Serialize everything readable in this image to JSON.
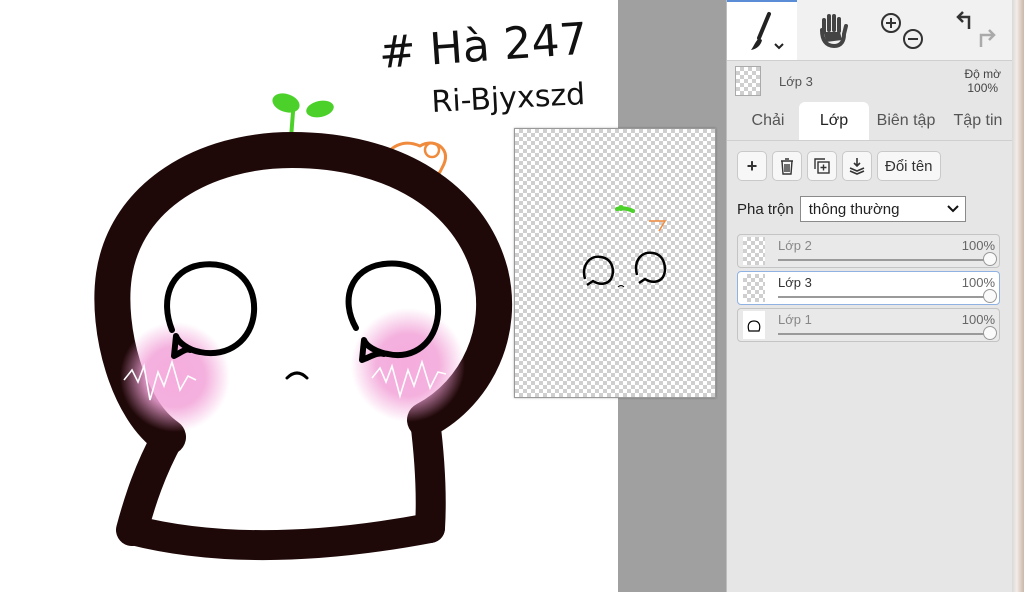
{
  "canvas": {
    "handwriting_line1": "# Hà 247",
    "handwriting_line2": "Ri-Bjyxszd"
  },
  "toolbar": {
    "tools": [
      {
        "name": "brush",
        "icon": "brush-icon",
        "active": true
      },
      {
        "name": "hand",
        "icon": "hand-icon",
        "active": false
      },
      {
        "name": "zoom",
        "icon": "zoom-in-out-icon",
        "active": false
      },
      {
        "name": "undo-redo",
        "icon": "undo-redo-icon",
        "active": false
      }
    ]
  },
  "current_layer": {
    "name": "Lớp 3",
    "opacity_label": "Độ mờ",
    "opacity_value": "100%"
  },
  "tabs": [
    {
      "label": "Chải",
      "active": false
    },
    {
      "label": "Lớp",
      "active": true
    },
    {
      "label": "Biên tập",
      "active": false
    },
    {
      "label": "Tập tin",
      "active": false
    }
  ],
  "layer_buttons": {
    "add": "+",
    "rename": "Đổi tên"
  },
  "blend": {
    "label": "Pha trộn",
    "selected": "thông thường"
  },
  "layers": [
    {
      "name": "Lớp 2",
      "opacity": "100%",
      "opacity_fraction": 1.0,
      "selected": false
    },
    {
      "name": "Lớp 3",
      "opacity": "100%",
      "opacity_fraction": 1.0,
      "selected": true
    },
    {
      "name": "Lớp 1",
      "opacity": "100%",
      "opacity_fraction": 1.0,
      "selected": false
    }
  ],
  "colors": {
    "outline": "#1f0808",
    "sprout": "#4cd12a",
    "blush": "#f2a3d8",
    "accent_orange": "#f08a3c",
    "panel_bg": "#e6e6e6",
    "active_tab": "#ffffff",
    "selection_border": "#8fb2e3"
  }
}
